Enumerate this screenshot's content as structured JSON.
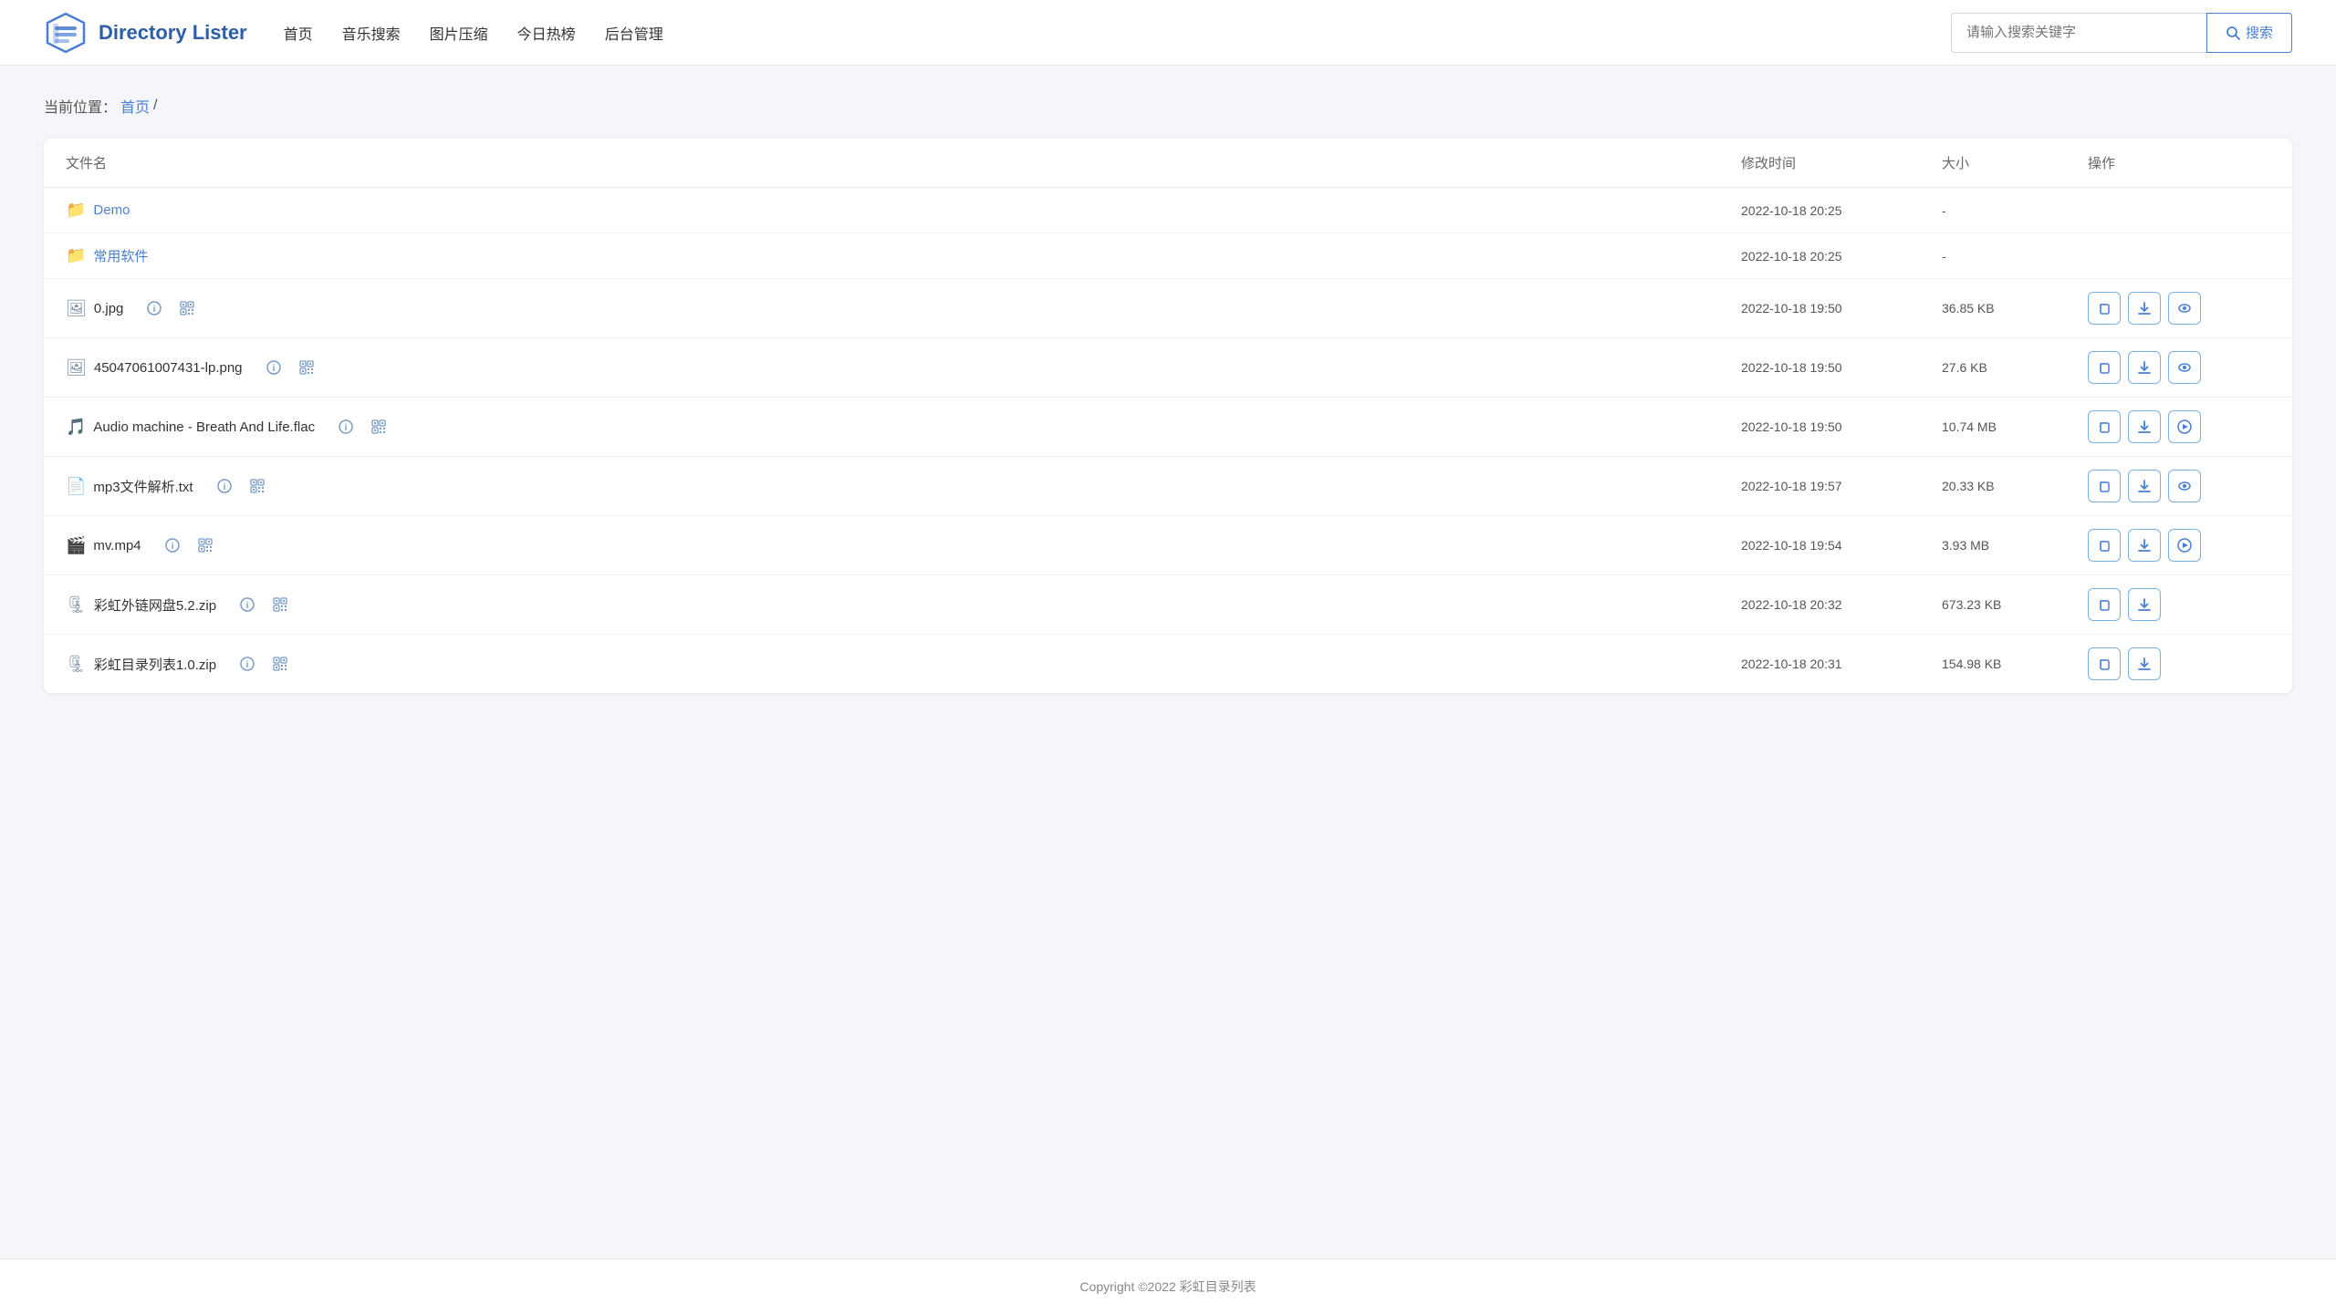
{
  "header": {
    "logo_text": "Directory Lister",
    "nav_items": [
      {
        "label": "首页",
        "key": "home"
      },
      {
        "label": "音乐搜索",
        "key": "music"
      },
      {
        "label": "图片压缩",
        "key": "image"
      },
      {
        "label": "今日热榜",
        "key": "hot"
      },
      {
        "label": "后台管理",
        "key": "admin"
      }
    ],
    "search_placeholder": "请输入搜索关键字",
    "search_btn_label": "搜索"
  },
  "breadcrumb": {
    "prefix": "当前位置：",
    "home_link": "首页",
    "separator": "/"
  },
  "table": {
    "columns": [
      "文件名",
      "修改时间",
      "大小",
      "操作"
    ],
    "rows": [
      {
        "type": "folder",
        "name": "Demo",
        "modified": "2022-10-18 20:25",
        "size": "-",
        "has_info": false,
        "has_qr": false,
        "ops": []
      },
      {
        "type": "folder",
        "name": "常用软件",
        "modified": "2022-10-18 20:25",
        "size": "-",
        "has_info": false,
        "has_qr": false,
        "ops": []
      },
      {
        "type": "file",
        "name": "0.jpg",
        "modified": "2022-10-18 19:50",
        "size": "36.85 KB",
        "has_info": true,
        "has_qr": true,
        "ops": [
          "copy",
          "download",
          "preview"
        ]
      },
      {
        "type": "file",
        "name": "45047061007431-lp.png",
        "modified": "2022-10-18 19:50",
        "size": "27.6 KB",
        "has_info": true,
        "has_qr": true,
        "ops": [
          "copy",
          "download",
          "preview"
        ]
      },
      {
        "type": "file",
        "name": "Audio machine - Breath And Life.flac",
        "modified": "2022-10-18 19:50",
        "size": "10.74 MB",
        "has_info": true,
        "has_qr": true,
        "ops": [
          "copy",
          "download",
          "play"
        ]
      },
      {
        "type": "file",
        "name": "mp3文件解析.txt",
        "modified": "2022-10-18 19:57",
        "size": "20.33 KB",
        "has_info": true,
        "has_qr": true,
        "ops": [
          "copy",
          "download",
          "preview"
        ]
      },
      {
        "type": "file",
        "name": "mv.mp4",
        "modified": "2022-10-18 19:54",
        "size": "3.93 MB",
        "has_info": true,
        "has_qr": true,
        "ops": [
          "copy",
          "download",
          "play"
        ]
      },
      {
        "type": "file",
        "name": "彩虹外链网盘5.2.zip",
        "modified": "2022-10-18 20:32",
        "size": "673.23 KB",
        "has_info": true,
        "has_qr": true,
        "ops": [
          "copy",
          "download"
        ]
      },
      {
        "type": "file",
        "name": "彩虹目录列表1.0.zip",
        "modified": "2022-10-18 20:31",
        "size": "154.98 KB",
        "has_info": true,
        "has_qr": true,
        "ops": [
          "copy",
          "download"
        ]
      }
    ]
  },
  "footer": {
    "text": "Copyright ©2022 彩虹目录列表"
  },
  "colors": {
    "accent": "#4a7fd4",
    "folder": "#4a7fd4"
  }
}
